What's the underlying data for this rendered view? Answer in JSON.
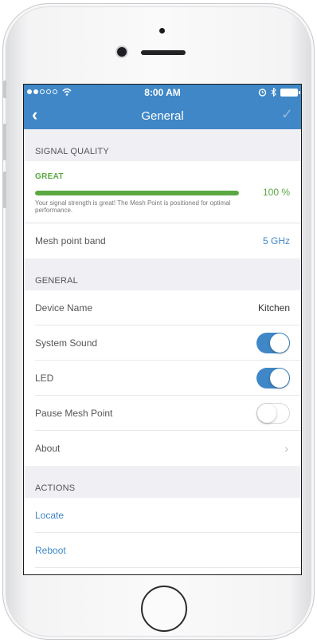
{
  "status_bar": {
    "carrier_signal": "●●○○○",
    "time": "8:00 AM"
  },
  "nav": {
    "back_label": "‹",
    "title": "General",
    "done_label": "✓"
  },
  "signal_quality": {
    "header": "SIGNAL QUALITY",
    "rating": "GREAT",
    "percent_label": "100 %",
    "percent_value": 1.0,
    "description": "Your signal strength is great! The Mesh Point is positioned for optimal performance.",
    "band_label": "Mesh point band",
    "band_value": "5 GHz",
    "accent_color": "#5aa842"
  },
  "general": {
    "header": "GENERAL",
    "device_name_label": "Device Name",
    "device_name_value": "Kitchen",
    "system_sound_label": "System Sound",
    "system_sound_on": true,
    "led_label": "LED",
    "led_on": true,
    "pause_label": "Pause Mesh Point",
    "pause_on": false,
    "about_label": "About",
    "about_chevron": "›"
  },
  "actions": {
    "header": "ACTIONS",
    "locate_label": "Locate",
    "reboot_label": "Reboot"
  },
  "theme": {
    "brand_blue": "#3f87c6"
  }
}
